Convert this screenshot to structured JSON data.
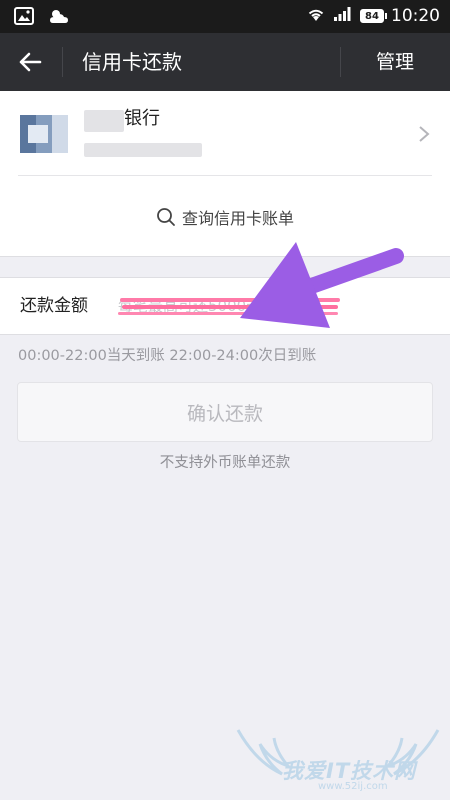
{
  "status_bar": {
    "time": "10:20",
    "battery": "84",
    "icons": [
      "image-icon",
      "weather-icon",
      "wifi-icon",
      "signal-icon",
      "battery-icon"
    ]
  },
  "nav": {
    "title": "信用卡还款",
    "manage_label": "管理",
    "back_icon": "back-arrow-icon"
  },
  "card": {
    "bank_name": "银行",
    "query_label": "查询信用卡账单",
    "query_icon": "search-icon",
    "chevron_icon": "chevron-right-icon"
  },
  "payment": {
    "amount_label": "还款金额",
    "amount_placeholder": "每笔最高可还5000元"
  },
  "time_info": "00:00-22:00当天到账  22:00-24:00次日到账",
  "confirm_label": "确认还款",
  "foreign_note": "不支持外币账单还款",
  "watermark": {
    "text": "我爱IT技术网",
    "url": "www.52ij.com"
  },
  "colors": {
    "nav_bg": "#2e2f33",
    "status_bg": "#1b1b1b",
    "page_bg": "#efeff4",
    "annotation_arrow": "#9b59e0",
    "annotation_strike": "#ff6fa0"
  }
}
